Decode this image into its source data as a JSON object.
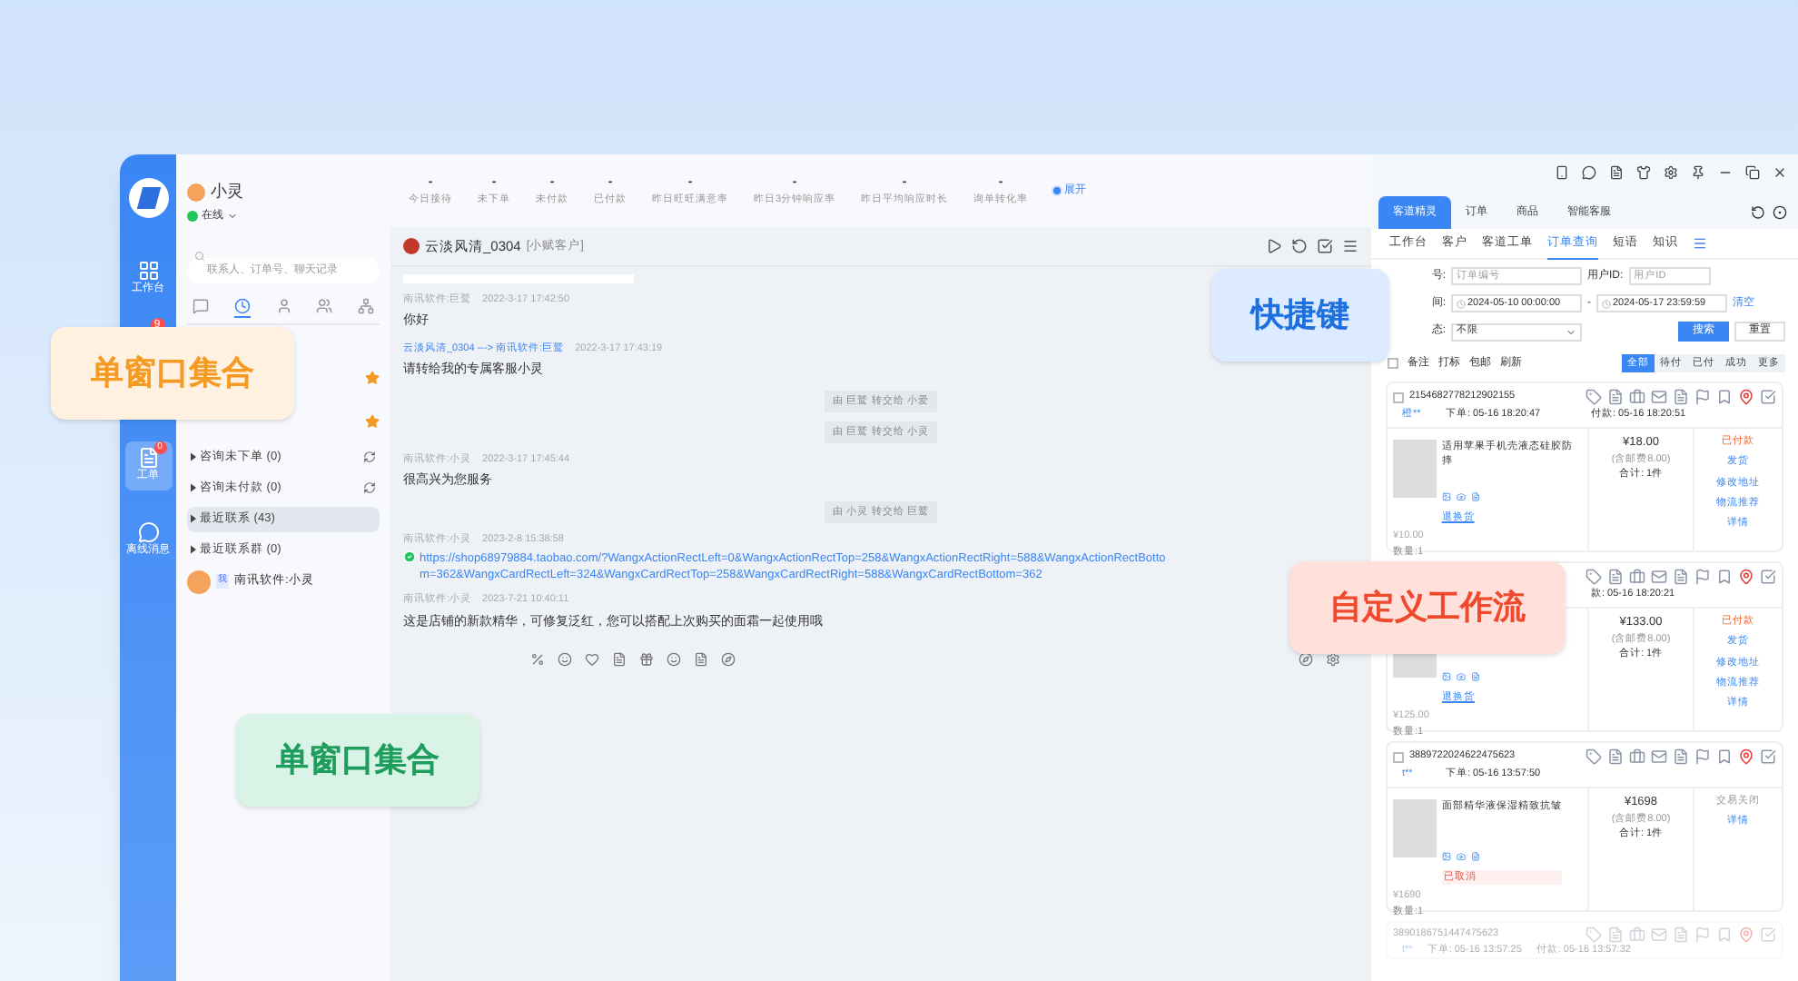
{
  "user": {
    "name": "小灵",
    "status": "在线"
  },
  "nav": [
    {
      "kind": "item",
      "label": "工作台",
      "selected": false
    },
    {
      "kind": "badge_only",
      "badge": "9",
      "selected": false
    },
    {
      "kind": "item",
      "label": "工单",
      "selected": true,
      "badge": "0"
    },
    {
      "kind": "item",
      "label": "离线消息",
      "selected": false
    }
  ],
  "search": {
    "placeholder": "联系人、订单号、聊天记录"
  },
  "contact_tabs": [
    {
      "selected": false
    },
    {
      "selected": true
    },
    {
      "selected": false
    },
    {
      "selected": false
    },
    {
      "selected": false
    }
  ],
  "contact_groups": [
    {
      "label": "咨询未下单 (0)",
      "selected": false,
      "refresh": true
    },
    {
      "label": "咨询未付款 (0)",
      "selected": false,
      "refresh": true
    },
    {
      "label": "最近联系 (43)",
      "selected": true,
      "refresh": false
    },
    {
      "label": "最近联系群 (0)",
      "selected": false,
      "refresh": false
    }
  ],
  "recent_contact": {
    "tag": "我",
    "name": "南讯软件:小灵"
  },
  "stats": [
    {
      "value": "-",
      "label": "今日接待"
    },
    {
      "value": "-",
      "label": "未下单"
    },
    {
      "value": "-",
      "label": "未付款"
    },
    {
      "value": "-",
      "label": "已付款"
    },
    {
      "value": "-",
      "label": "昨日旺旺满意率"
    },
    {
      "value": "-",
      "label": "昨日3分钟响应率"
    },
    {
      "value": "-",
      "label": "昨日平均响应时长"
    },
    {
      "value": "-",
      "label": "询单转化率"
    }
  ],
  "expand_button": "展开",
  "chat": {
    "title": "云淡风清_0304",
    "tag": "[小赋客户]"
  },
  "messages": [
    {
      "kind": "message",
      "sender": "南讯软件:巨鹫",
      "time": "2022-3-17 17:42:50",
      "text": "你好"
    },
    {
      "kind": "transfer_message",
      "sender": "云淡风清_0304 ---> 南讯软件:巨鹫",
      "time": "2022-3-17 17:43:19",
      "text": "请转给我的专属客服小灵"
    },
    {
      "kind": "notice",
      "text": "由 巨鹫 转交给 小爱"
    },
    {
      "kind": "notice",
      "text": "由 巨鹫 转交给 小灵"
    },
    {
      "kind": "message",
      "sender": "南讯软件:小灵",
      "time": "2022-3-17 17:45:44",
      "text": "很高兴为您服务"
    },
    {
      "kind": "notice",
      "text": "由 小灵 转交给 巨鹫"
    },
    {
      "kind": "link",
      "sender": "南讯软件:小灵",
      "time": "2023-2-8 15:38:58",
      "text": "https://shop68979884.taobao.com/?WangxActionRectLeft=0&WangxActionRectTop=258&WangxActionRectRight=588&WangxActionRectBottom=362&WangxCardRectLeft=324&WangxCardRectTop=258&WangxCardRectRight=588&WangxCardRectBottom=362"
    },
    {
      "kind": "message",
      "sender": "南讯软件:小灵",
      "time": "2023-7-21 10:40:11",
      "text": "这是店铺的新款精华，可修复泛红，您可以搭配上次购买的面霜一起使用哦"
    }
  ],
  "main_tabs": [
    {
      "label": "客道精灵",
      "selected": true
    },
    {
      "label": "订单",
      "selected": false
    },
    {
      "label": "商品",
      "selected": false
    },
    {
      "label": "智能客服",
      "selected": false
    }
  ],
  "sub_tabs": [
    {
      "label": "工作台",
      "selected": false
    },
    {
      "label": "客户",
      "selected": false
    },
    {
      "label": "客道工单",
      "selected": false
    },
    {
      "label": "订单查询",
      "selected": true
    },
    {
      "label": "短语",
      "selected": false
    },
    {
      "label": "知识",
      "selected": false
    }
  ],
  "form": {
    "order_label": "号:",
    "order_placeholder": "订单编号",
    "user_label": "用户ID:",
    "user_placeholder": "用户ID",
    "time_label": "间:",
    "time_from": "2024-05-10 00:00:00",
    "range_separator": "-",
    "time_to": "2024-05-17 23:59:59",
    "clear": "清空",
    "status_label": "态:",
    "status_value": "不限",
    "search": "搜索",
    "reset": "重置"
  },
  "select_all_checked": false,
  "actions": [
    "备注",
    "打标",
    "包邮",
    "刷新"
  ],
  "filters": [
    {
      "label": "全部",
      "selected": true
    },
    {
      "label": "待付",
      "selected": false
    },
    {
      "label": "已付",
      "selected": false
    },
    {
      "label": "成功",
      "selected": false
    },
    {
      "label": "更多",
      "selected": false
    }
  ],
  "orders": [
    {
      "checked": false,
      "id": "2154682778212902155",
      "buyer": "橙**",
      "ordered": "下单: 05-16 18:20:47",
      "paid": "付款: 05-16 18:20:51",
      "product": "适用苹果手机壳液态硅胶防摔",
      "product_state": "退换货",
      "cancelled": false,
      "unit_price": "¥10.00",
      "qty": "数量:1",
      "total": "¥18.00",
      "shipping": "(含邮费8.00)",
      "count": "合计: 1件",
      "status": "已付款",
      "closed": false,
      "links": [
        "发货",
        "修改地址",
        "物流推荐",
        "详情"
      ]
    },
    {
      "paid": "款: 05-16 18:20:21",
      "product_state": "退换货",
      "cancelled": false,
      "unit_price": "¥125.00",
      "qty": "数量:1",
      "total": "¥133.00",
      "shipping": "(含邮费8.00)",
      "count": "合计: 1件",
      "status": "已付款",
      "closed": false,
      "links": [
        "发货",
        "修改地址",
        "物流推荐",
        "详情"
      ]
    },
    {
      "checked": false,
      "id": "3889722024622475623",
      "buyer": "t**",
      "ordered": "下单: 05-16 13:57:50",
      "product": "面部精华液保湿精致抗皱",
      "product_state": "已取消",
      "cancelled": true,
      "unit_price": "¥1690",
      "qty": "数量:1",
      "total": "¥1698",
      "shipping": "(含邮费8.00)",
      "count": "合计: 1件",
      "status": "交易关闭",
      "closed": true,
      "links": [
        "详情"
      ]
    }
  ],
  "faded_order": {
    "id": "3890186751447475623",
    "buyer": "t**",
    "ordered": "下单: 05-16 13:57:25",
    "paid": "付款: 05-16 13:57:32"
  },
  "callouts": [
    {
      "label": "单窗口集合",
      "color": "#f59a23"
    },
    {
      "label": "快捷键",
      "color": "#1e6fe0"
    },
    {
      "label": "自定义工作流",
      "color": "#f04a2e"
    },
    {
      "label": "单窗口集合",
      "color": "#1f9d5c"
    }
  ]
}
